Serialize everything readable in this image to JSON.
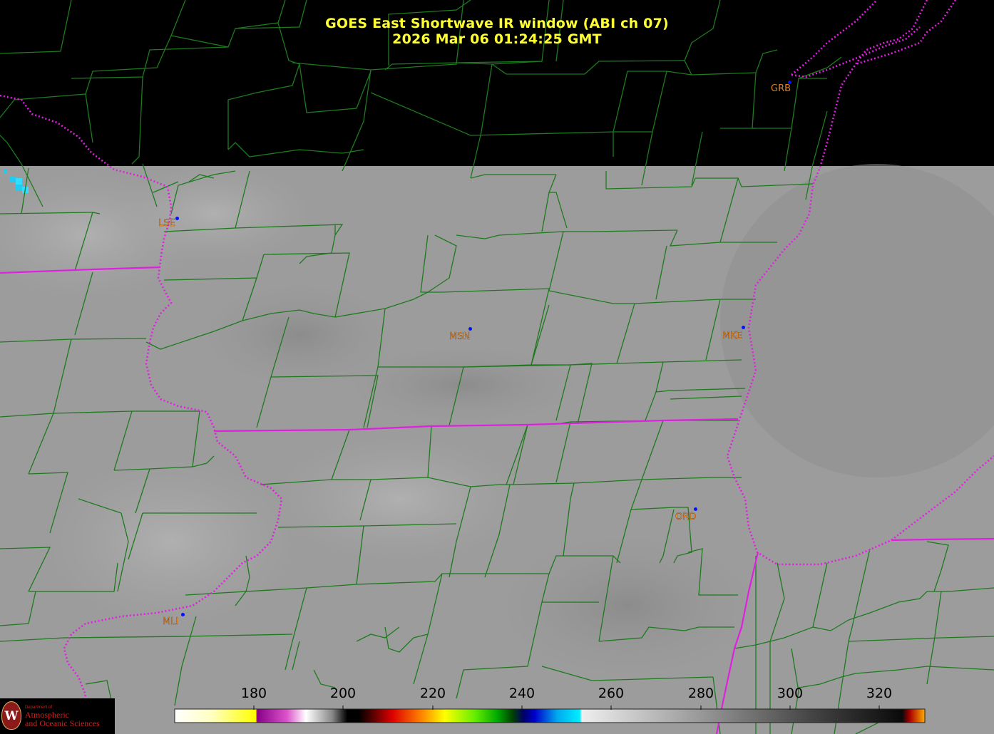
{
  "title": {
    "line1": "GOES East Shortwave IR window (ABI ch 07)",
    "line2": "2026 Mar 06  01:24:25 GMT"
  },
  "cities": [
    {
      "code": "GRB"
    },
    {
      "code": "LSE"
    },
    {
      "code": "MSN"
    },
    {
      "code": "MKE"
    },
    {
      "code": "ORD"
    },
    {
      "code": "MLI"
    }
  ],
  "colorbar": {
    "ticks": [
      "180",
      "200",
      "220",
      "240",
      "260",
      "280",
      "300",
      "320"
    ]
  },
  "logo": {
    "dept": "Department of",
    "line1": "Atmospheric",
    "line2": "and Oceanic Sciences",
    "seal_letter": "W"
  },
  "colors": {
    "title": "#ffff33",
    "city_label": "#ff9933",
    "county_lines": "#1e7a1e",
    "state_lines": "#e020e0",
    "background_cloud_gray": "#9a9a9a",
    "no_data": "#000000"
  }
}
